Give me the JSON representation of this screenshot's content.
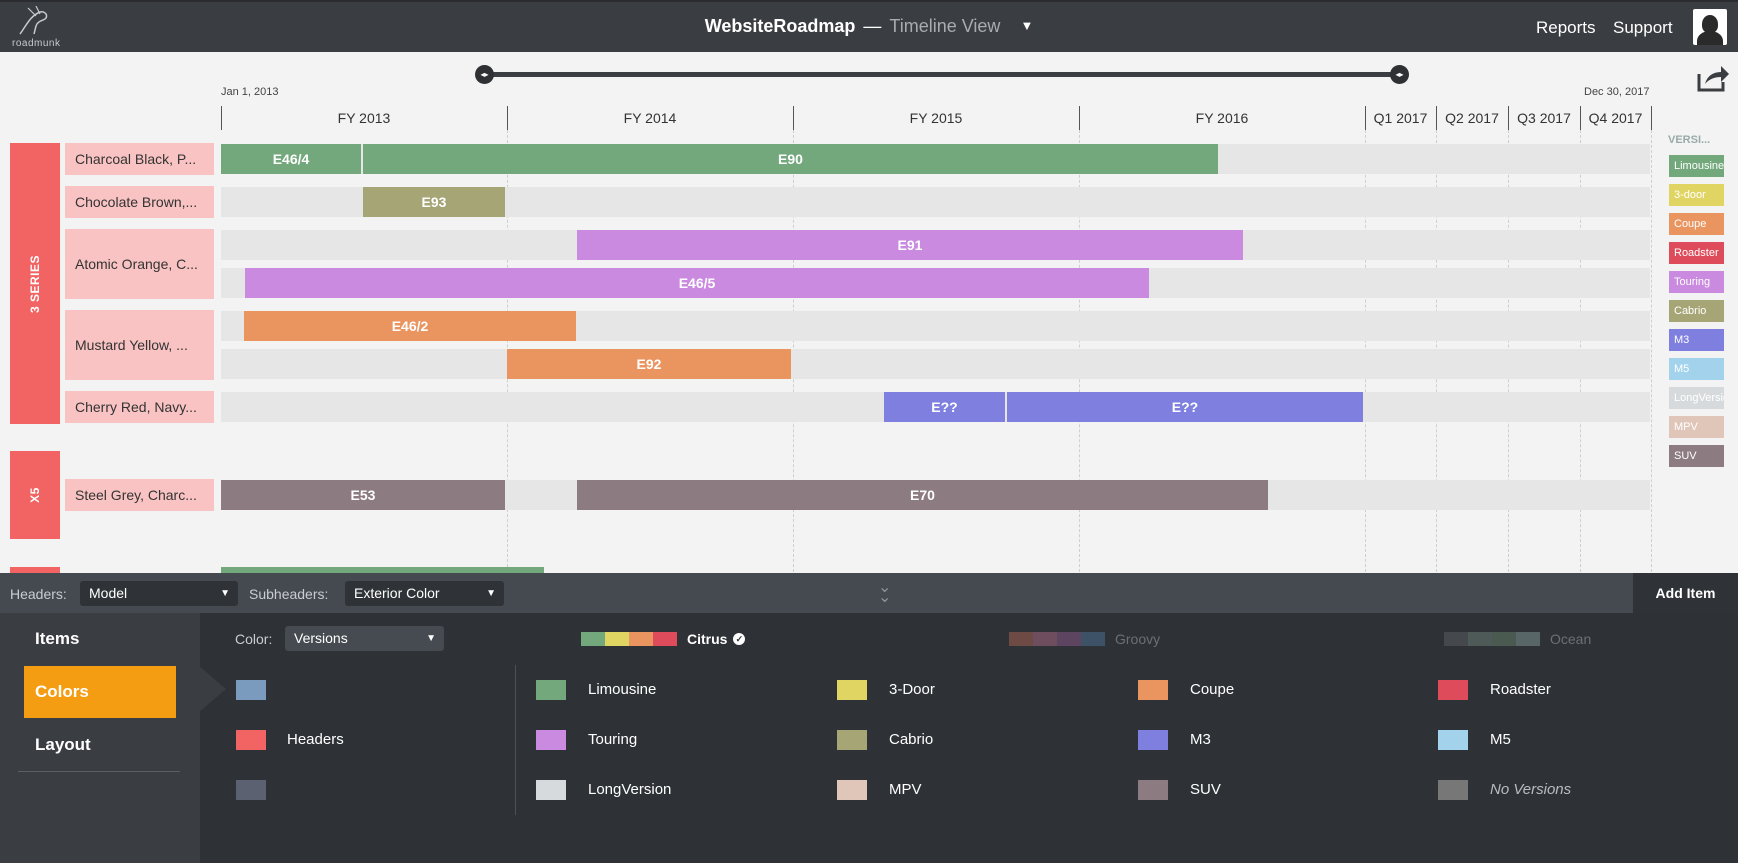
{
  "topbar": {
    "logo_text": "roadmunk",
    "title": "WebsiteRoadmap",
    "separator": "—",
    "view": "Timeline View",
    "caret": "▼",
    "nav": [
      "Reports",
      "Support"
    ]
  },
  "timeline": {
    "start_label": "Jan 1, 2013",
    "end_label": "Dec 30, 2017",
    "periods": [
      {
        "label": "FY 2013"
      },
      {
        "label": "FY 2014"
      },
      {
        "label": "FY 2015"
      },
      {
        "label": "FY 2016"
      },
      {
        "label": "Q1 2017"
      },
      {
        "label": "Q2 2017"
      },
      {
        "label": "Q3 2017"
      },
      {
        "label": "Q4 2017"
      }
    ]
  },
  "headers": [
    {
      "label": "3 SERIES",
      "color": "#f26363",
      "subheaders": [
        {
          "label": "Charcoal Black, P...",
          "bars": [
            {
              "label": "E46/4",
              "version": "Limousine"
            },
            {
              "label": "E90",
              "version": "Limousine"
            }
          ]
        },
        {
          "label": "Chocolate Brown,...",
          "bars": [
            {
              "label": "E93",
              "version": "Cabrio"
            }
          ]
        },
        {
          "label": "Atomic Orange, C...",
          "bars": [
            {
              "label": "E91",
              "version": "Touring"
            },
            {
              "label": "E46/5",
              "version": "Touring"
            }
          ]
        },
        {
          "label": "Mustard Yellow, ...",
          "bars": [
            {
              "label": "E46/2",
              "version": "Coupe"
            },
            {
              "label": "E92",
              "version": "Coupe"
            }
          ]
        },
        {
          "label": "Cherry Red, Navy...",
          "bars": [
            {
              "label": "E??",
              "version": "M3"
            },
            {
              "label": "E??",
              "version": "M3"
            }
          ]
        }
      ]
    },
    {
      "label": "X5",
      "color": "#f26363",
      "subheaders": [
        {
          "label": "Steel Grey, Charc...",
          "bars": [
            {
              "label": "E53",
              "version": "SUV"
            },
            {
              "label": "E70",
              "version": "SUV"
            }
          ]
        }
      ]
    }
  ],
  "legend": {
    "title": "VERSI...",
    "items": [
      {
        "label": "Limousine",
        "color": "#72a87c"
      },
      {
        "label": "3-door",
        "color": "#e0d563"
      },
      {
        "label": "Coupe",
        "color": "#ea9460"
      },
      {
        "label": "Roadster",
        "color": "#de4c5b"
      },
      {
        "label": "Touring",
        "color": "#c98ae0"
      },
      {
        "label": "Cabrio",
        "color": "#a6a576"
      },
      {
        "label": "M3",
        "color": "#7e7fdf"
      },
      {
        "label": "M5",
        "color": "#a3d3ec"
      },
      {
        "label": "LongVersion",
        "color": "#d7dadc"
      },
      {
        "label": "MPV",
        "color": "#e0c6b8"
      },
      {
        "label": "SUV",
        "color": "#8c7b80"
      }
    ]
  },
  "bottom_bar": {
    "headers_label": "Headers:",
    "headers_value": "Model",
    "subheaders_label": "Subheaders:",
    "subheaders_value": "Exterior Color",
    "add_item": "Add Item"
  },
  "side_menu": [
    {
      "label": "Items",
      "active": false
    },
    {
      "label": "Colors",
      "active": true
    },
    {
      "label": "Layout",
      "active": false
    }
  ],
  "colors_panel": {
    "color_label": "Color:",
    "color_value": "Versions",
    "themes": [
      {
        "name": "Citrus",
        "selected": true,
        "swatches": [
          "#72a87c",
          "#e0d563",
          "#ea9460",
          "#de4c5b"
        ]
      },
      {
        "name": "Groovy",
        "selected": false,
        "swatches": [
          "#6e4a44",
          "#6e4e5e",
          "#5d4461",
          "#3e5267"
        ]
      },
      {
        "name": "Ocean",
        "selected": false,
        "swatches": [
          "#45494d",
          "#4d5a58",
          "#4a5a50",
          "#586668"
        ]
      }
    ],
    "base_colors": [
      {
        "label": "",
        "color": "#7a9bbd"
      },
      {
        "label": "Headers",
        "color": "#f26363"
      },
      {
        "label": "",
        "color": "#5b6170"
      }
    ],
    "versions": [
      {
        "label": "Limousine",
        "color": "#72a87c"
      },
      {
        "label": "3-Door",
        "color": "#e0d563"
      },
      {
        "label": "Coupe",
        "color": "#ea9460"
      },
      {
        "label": "Roadster",
        "color": "#de4c5b"
      },
      {
        "label": "Touring",
        "color": "#c98ae0"
      },
      {
        "label": "Cabrio",
        "color": "#a6a576"
      },
      {
        "label": "M3",
        "color": "#7e7fdf"
      },
      {
        "label": "M5",
        "color": "#a3d3ec"
      },
      {
        "label": "LongVersion",
        "color": "#d7dadc"
      },
      {
        "label": "MPV",
        "color": "#e0c6b8"
      },
      {
        "label": "SUV",
        "color": "#8c7b80"
      },
      {
        "label": "No Versions",
        "color": "#777777"
      }
    ]
  }
}
